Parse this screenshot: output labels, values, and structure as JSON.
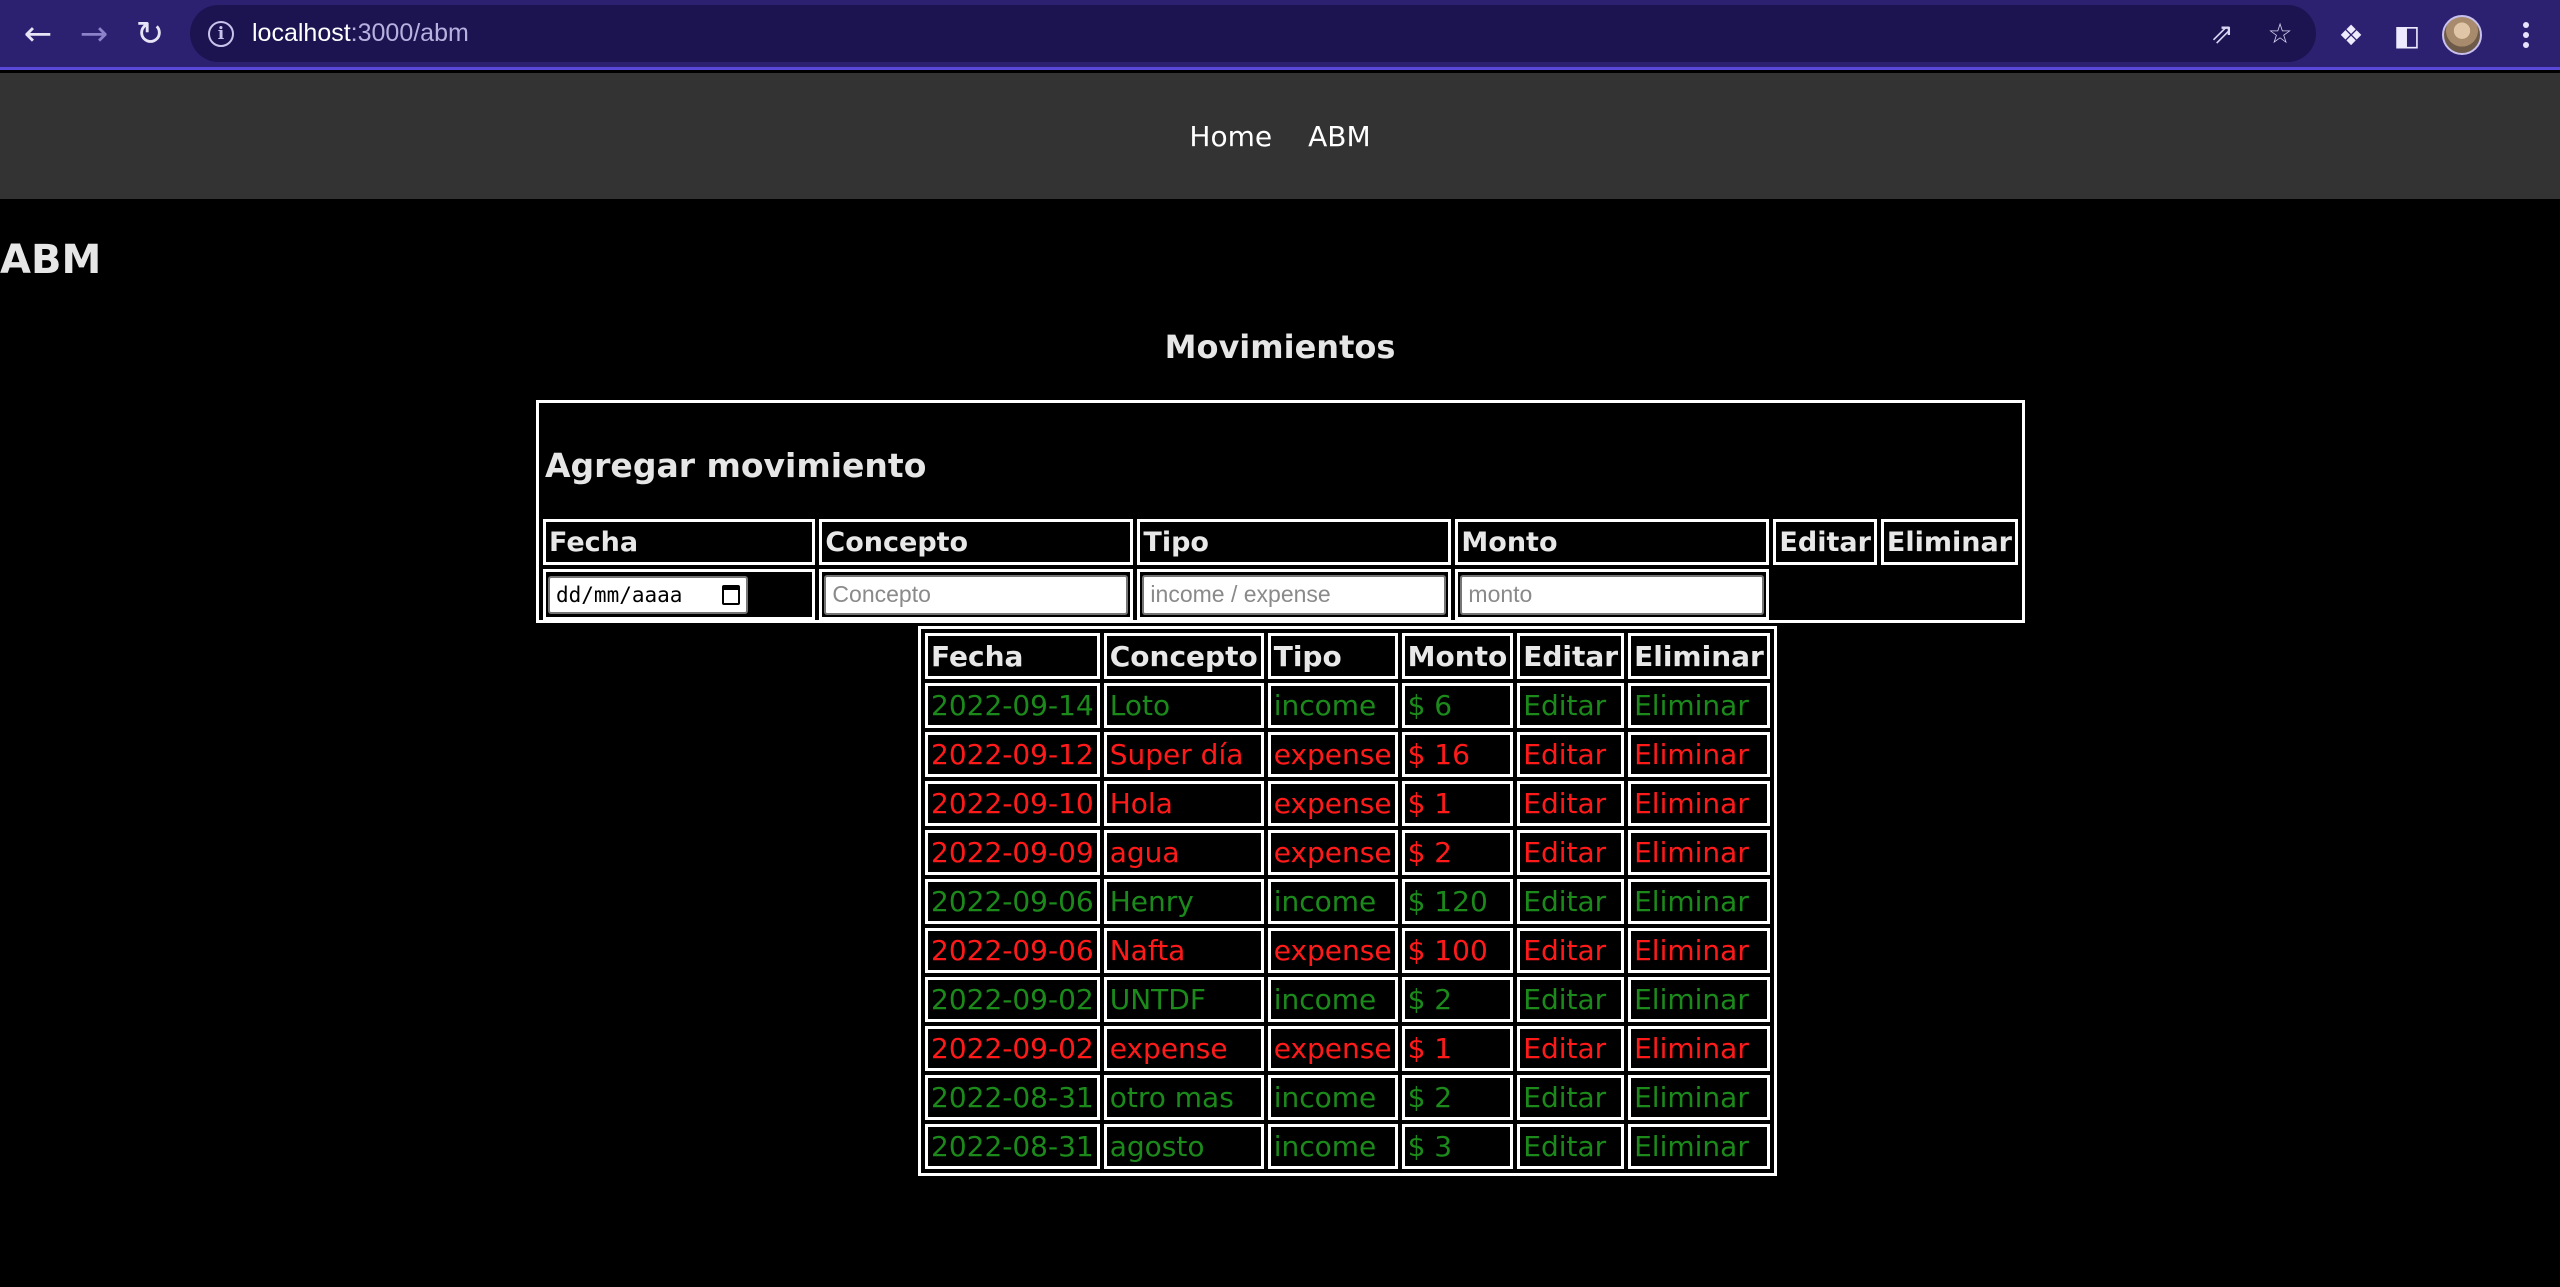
{
  "browser": {
    "url_host": "localhost",
    "url_path": ":3000/abm"
  },
  "nav": {
    "home": "Home",
    "abm": "ABM"
  },
  "page": {
    "title": "ABM",
    "section_title": "Movimientos"
  },
  "add_form": {
    "title": "Agregar movimiento",
    "headers": [
      "Fecha",
      "Concepto",
      "Tipo",
      "Monto",
      "Editar",
      "Eliminar"
    ],
    "date_placeholder": "dd/mm/aaaa",
    "concepto_placeholder": "Concepto",
    "tipo_placeholder": "income / expense",
    "monto_placeholder": "monto"
  },
  "movements": {
    "headers": [
      "Fecha",
      "Concepto",
      "Tipo",
      "Monto",
      "Editar",
      "Eliminar"
    ],
    "rows": [
      {
        "fecha": "2022-09-14",
        "concepto": "Loto",
        "tipo": "income",
        "monto": "$ 6",
        "editar": "Editar",
        "eliminar": "Eliminar"
      },
      {
        "fecha": "2022-09-12",
        "concepto": "Super día",
        "tipo": "expense",
        "monto": "$ 16",
        "editar": "Editar",
        "eliminar": "Eliminar"
      },
      {
        "fecha": "2022-09-10",
        "concepto": "Hola",
        "tipo": "expense",
        "monto": "$ 1",
        "editar": "Editar",
        "eliminar": "Eliminar"
      },
      {
        "fecha": "2022-09-09",
        "concepto": "agua",
        "tipo": "expense",
        "monto": "$ 2",
        "editar": "Editar",
        "eliminar": "Eliminar"
      },
      {
        "fecha": "2022-09-06",
        "concepto": "Henry",
        "tipo": "income",
        "monto": "$ 120",
        "editar": "Editar",
        "eliminar": "Eliminar"
      },
      {
        "fecha": "2022-09-06",
        "concepto": "Nafta",
        "tipo": "expense",
        "monto": "$ 100",
        "editar": "Editar",
        "eliminar": "Eliminar"
      },
      {
        "fecha": "2022-09-02",
        "concepto": "UNTDF",
        "tipo": "income",
        "monto": "$ 2",
        "editar": "Editar",
        "eliminar": "Eliminar"
      },
      {
        "fecha": "2022-09-02",
        "concepto": "expense",
        "tipo": "expense",
        "monto": "$ 1",
        "editar": "Editar",
        "eliminar": "Eliminar"
      },
      {
        "fecha": "2022-08-31",
        "concepto": "otro mas",
        "tipo": "income",
        "monto": "$ 2",
        "editar": "Editar",
        "eliminar": "Eliminar"
      },
      {
        "fecha": "2022-08-31",
        "concepto": "agosto",
        "tipo": "income",
        "monto": "$ 3",
        "editar": "Editar",
        "eliminar": "Eliminar"
      }
    ]
  },
  "colors": {
    "income": "#1b8a1b",
    "expense": "#ff1a1a"
  }
}
